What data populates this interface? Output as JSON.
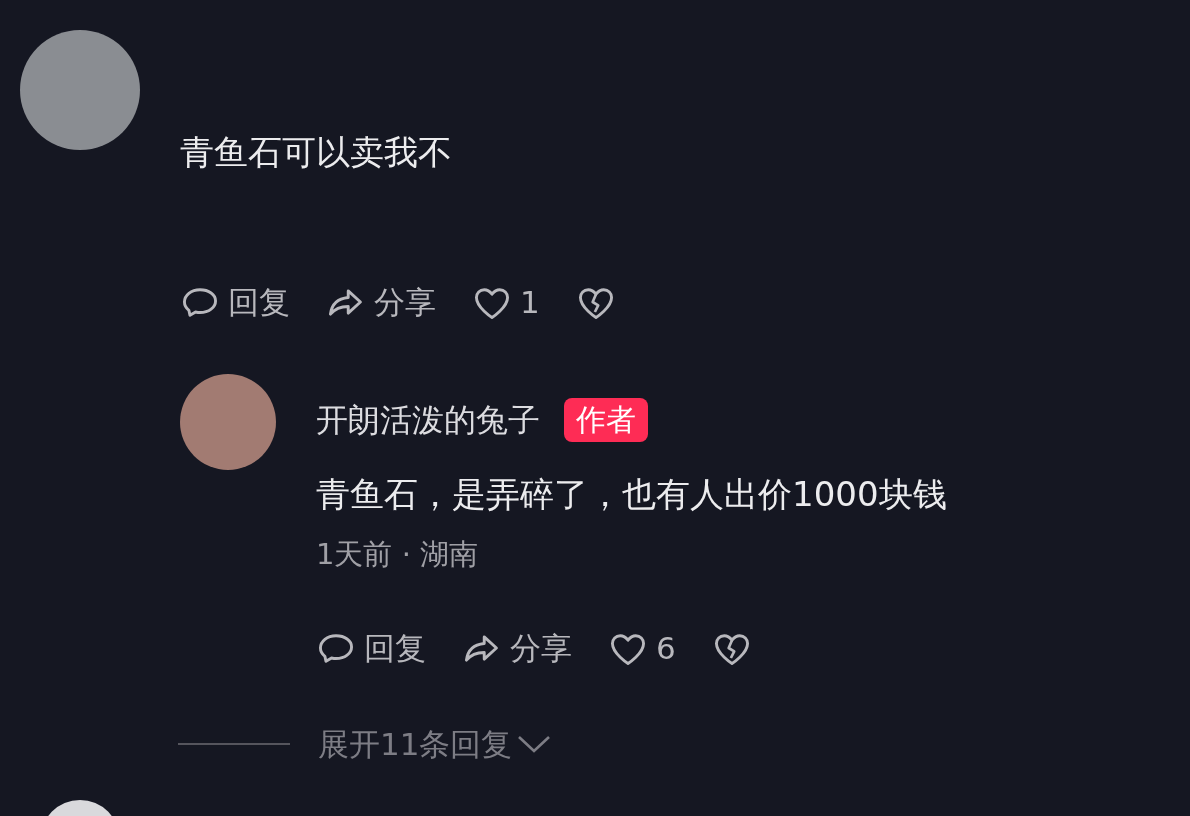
{
  "comment": {
    "text": "青鱼石可以卖我不",
    "actions": [
      {
        "kind": "reply",
        "label": "回复"
      },
      {
        "kind": "share",
        "label": "分享"
      },
      {
        "kind": "like",
        "label": "1"
      },
      {
        "kind": "dislike"
      }
    ]
  },
  "reply": {
    "author": "开朗活泼的兔子",
    "badge": "作者",
    "text": "青鱼石，是弄碎了，也有人出价1000块钱",
    "meta": "1天前 · 湖南",
    "actions": [
      {
        "kind": "reply",
        "label": "回复"
      },
      {
        "kind": "share",
        "label": "分享"
      },
      {
        "kind": "like",
        "label": "6"
      },
      {
        "kind": "dislike"
      }
    ]
  },
  "expand_replies": {
    "label": "展开11条回复"
  }
}
